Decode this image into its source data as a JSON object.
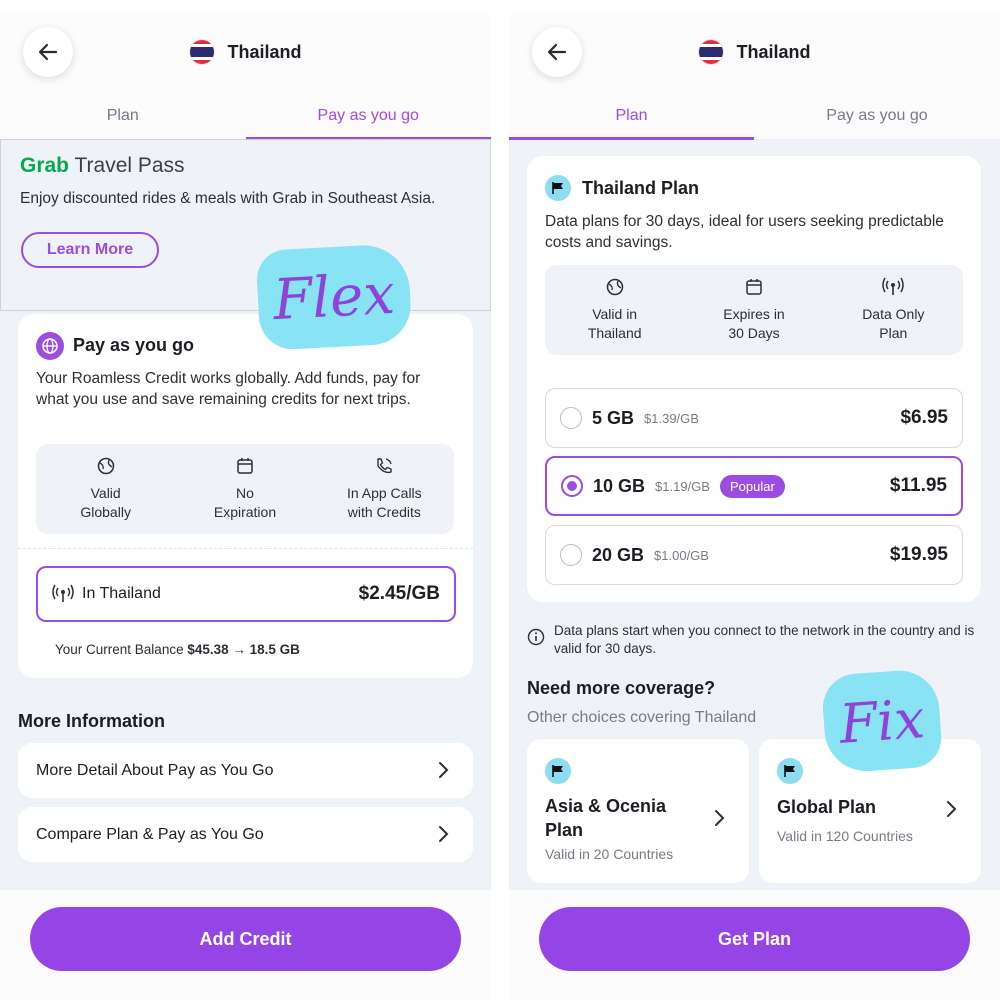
{
  "left": {
    "header": {
      "title": "Thailand"
    },
    "tabs": [
      {
        "label": "Plan"
      },
      {
        "label": "Pay as you go"
      }
    ],
    "promo": {
      "logo_grab": "Grab",
      "logo_rest": " Travel Pass",
      "description": "Enjoy discounted rides & meals with Grab in Southeast Asia.",
      "button": "Learn More"
    },
    "sticker": "Flex",
    "payg": {
      "title": "Pay as you go",
      "description": "Your Roamless Credit works globally. Add funds, pay for what you use and save remaining credits for next trips.",
      "features": [
        {
          "icon": "globe-icon",
          "line1": "Valid",
          "line2": "Globally"
        },
        {
          "icon": "calendar-icon",
          "line1": "No",
          "line2": "Expiration"
        },
        {
          "icon": "phone-icon",
          "line1": "In App Calls",
          "line2": "with Credits"
        }
      ],
      "rate_label": "In Thailand",
      "rate_value": "$2.45/GB",
      "balance_prefix": "Your Current Balance ",
      "balance_value": "$45.38 → 18.5 GB"
    },
    "more_info": {
      "heading": "More Information",
      "links": [
        "More Detail About Pay as You Go",
        "Compare Plan & Pay as You Go"
      ]
    },
    "cta": "Add Credit"
  },
  "right": {
    "header": {
      "title": "Thailand"
    },
    "tabs": [
      {
        "label": "Plan"
      },
      {
        "label": "Pay as you go"
      }
    ],
    "plan_card": {
      "title": "Thailand Plan",
      "description": "Data plans for 30 days, ideal for users seeking predictable costs and savings.",
      "features": [
        {
          "icon": "globe-icon",
          "line1": "Valid in",
          "line2": "Thailand"
        },
        {
          "icon": "calendar-icon",
          "line1": "Expires in",
          "line2": "30 Days"
        },
        {
          "icon": "signal-icon",
          "line1": "Data Only",
          "line2": "Plan"
        }
      ],
      "options": [
        {
          "size": "5 GB",
          "per_gb": "$1.39/GB",
          "badge": "",
          "price": "$6.95",
          "selected": false
        },
        {
          "size": "10 GB",
          "per_gb": "$1.19/GB",
          "badge": "Popular",
          "price": "$11.95",
          "selected": true
        },
        {
          "size": "20 GB",
          "per_gb": "$1.00/GB",
          "badge": "",
          "price": "$19.95",
          "selected": false
        }
      ]
    },
    "note": "Data plans start when you connect to the network in the country and is valid for 30 days.",
    "sticker": "Fix",
    "coverage": {
      "heading": "Need more coverage?",
      "subheading": "Other choices covering Thailand",
      "cards": [
        {
          "title_line1": "Asia & Ocenia",
          "title_line2": "Plan",
          "subtitle": "Valid in 20 Countries"
        },
        {
          "title_line1": "Global Plan",
          "title_line2": "",
          "subtitle": "Valid in 120 Countries"
        }
      ]
    },
    "cta": "Get Plan"
  },
  "colors": {
    "accent": "#9a4de0",
    "button": "#9545e6",
    "sticker_bg": "#88e3f5",
    "grab_green": "#06a94f",
    "background": "#eff2f7"
  }
}
